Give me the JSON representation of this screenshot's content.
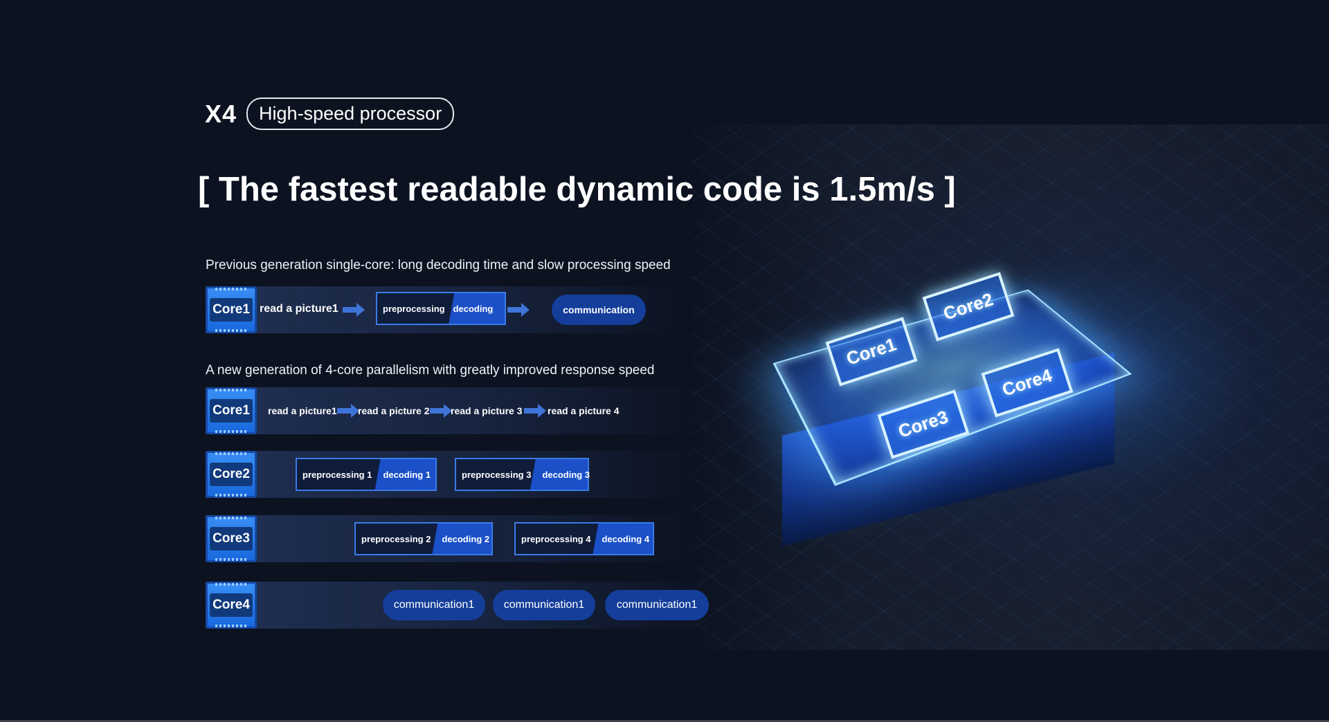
{
  "header": {
    "model": "X4",
    "pill": "High-speed processor"
  },
  "headline": "[ The fastest readable dynamic code is 1.5m/s ]",
  "single_core": {
    "label": "Previous generation single-core: long decoding time and slow processing speed",
    "core": "Core1",
    "read": "read a picture1",
    "pre": "preprocessing",
    "dec": "decoding",
    "comm": "communication"
  },
  "quad_core": {
    "label": "A new generation of 4-core parallelism with greatly improved response speed",
    "core1": {
      "name": "Core1",
      "steps": [
        "read a picture1",
        "read a picture  2",
        "read a picture 3",
        "read a picture 4"
      ]
    },
    "core2": {
      "name": "Core2",
      "blocks": [
        {
          "pre": "preprocessing 1",
          "dec": "decoding 1"
        },
        {
          "pre": "preprocessing 3",
          "dec": "decoding 3"
        }
      ]
    },
    "core3": {
      "name": "Core3",
      "blocks": [
        {
          "pre": "preprocessing 2",
          "dec": "decoding 2"
        },
        {
          "pre": "preprocessing 4",
          "dec": "decoding 4"
        }
      ]
    },
    "core4": {
      "name": "Core4",
      "comms": [
        "communication1",
        "communication1",
        "communication1"
      ]
    }
  },
  "chip_cores": [
    "Core1",
    "Core2",
    "Core3",
    "Core4"
  ]
}
